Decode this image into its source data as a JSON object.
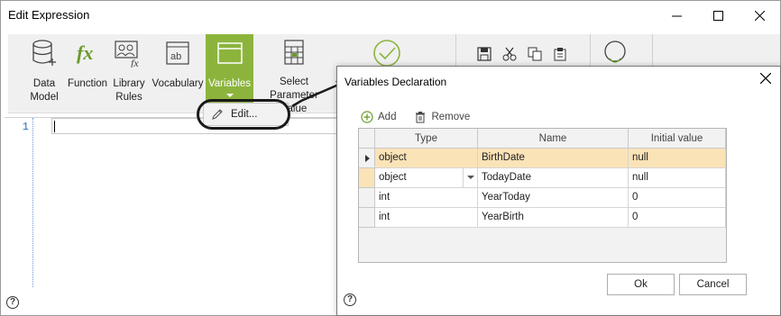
{
  "window": {
    "title": "Edit Expression"
  },
  "window_controls": {
    "minimize": "—",
    "maximize": "☐",
    "close": "✕"
  },
  "ribbon": {
    "buttons": [
      {
        "key": "data-model",
        "label": "Data\nModel",
        "icon": "database-add-icon"
      },
      {
        "key": "function",
        "label": "Function",
        "icon": "function-fx-icon"
      },
      {
        "key": "library-rules",
        "label": "Library\nRules",
        "icon": "library-rules-icon"
      },
      {
        "key": "vocabulary",
        "label": "Vocabulary",
        "icon": "vocabulary-ab-icon"
      },
      {
        "key": "variables",
        "label": "Variables",
        "icon": "variables-icon",
        "active": true
      },
      {
        "key": "select-parameter-value",
        "label": "Select Parameter\nValue",
        "icon": "table-select-icon"
      }
    ],
    "accent_color": "#8cb43c"
  },
  "editor": {
    "line_number": "1"
  },
  "menu": {
    "edit_label": "Edit..."
  },
  "dialog": {
    "title": "Variables Declaration",
    "close": "✕",
    "toolbar": {
      "add_label": "Add",
      "remove_label": "Remove"
    },
    "columns": [
      "Type",
      "Name",
      "Initial value"
    ],
    "rows": [
      {
        "type": "object",
        "name": "BirthDate",
        "initial": "null"
      },
      {
        "type": "object",
        "name": "TodayDate",
        "initial": "null"
      },
      {
        "type": "int",
        "name": "YearToday",
        "initial": "0"
      },
      {
        "type": "int",
        "name": "YearBirth",
        "initial": "0"
      }
    ],
    "ok_label": "Ok",
    "cancel_label": "Cancel",
    "row_highlight_color": "#fbe3b8"
  },
  "help": "?"
}
